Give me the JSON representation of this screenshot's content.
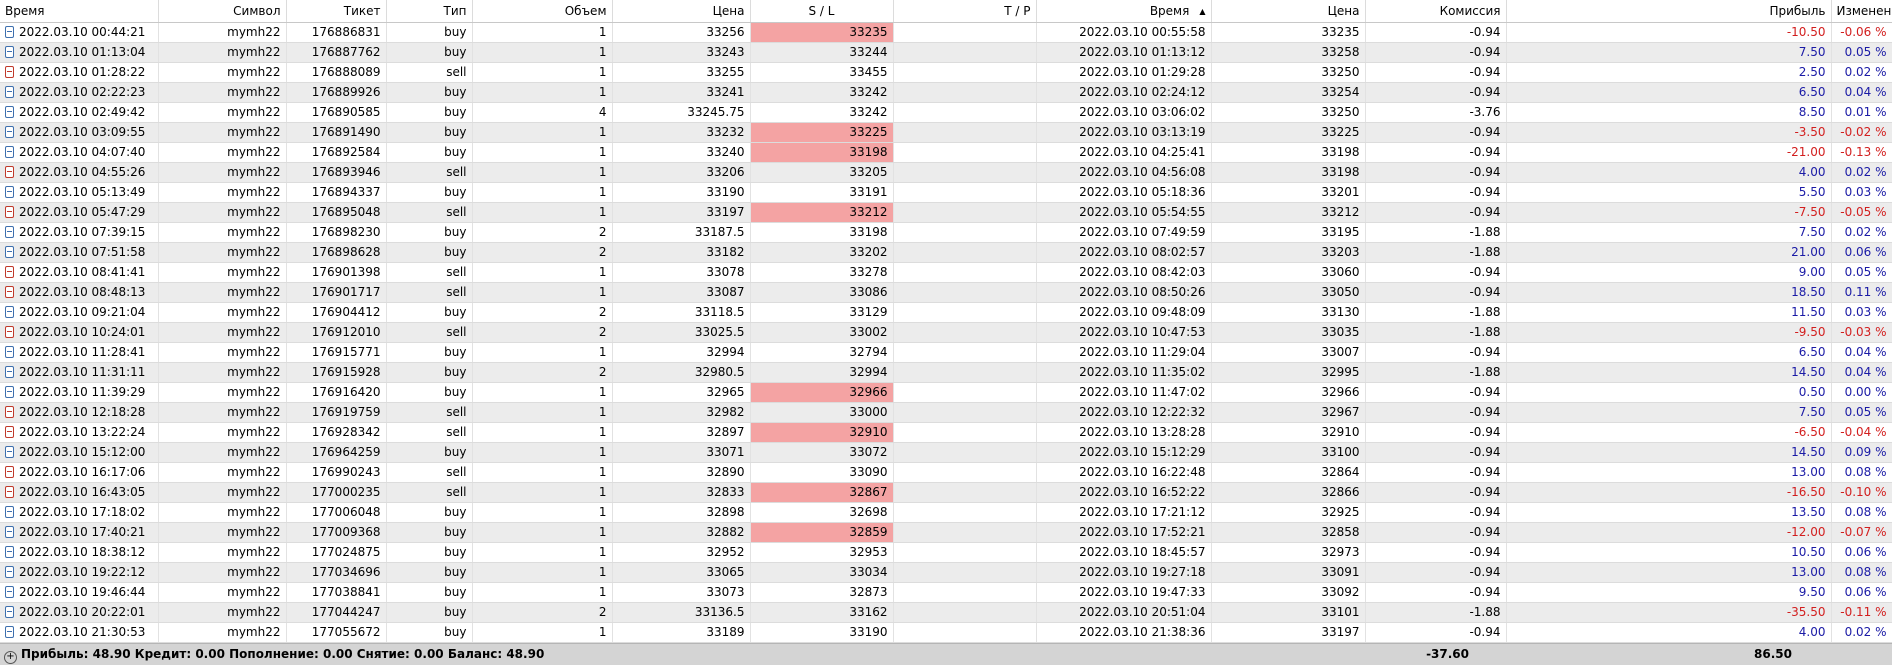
{
  "headers": {
    "time": "Время",
    "symbol": "Символ",
    "ticket": "Тикет",
    "type": "Тип",
    "volume": "Объем",
    "price": "Цена",
    "sl": "S / L",
    "tp": "T / P",
    "close_time": "Время",
    "close_price": "Цена",
    "commission": "Комиссия",
    "profit": "Прибыль",
    "change": "Изменение"
  },
  "sort_arrow": "▲",
  "rows": [
    {
      "time": "2022.03.10 00:44:21",
      "symbol": "mymh22",
      "ticket": "176886831",
      "type": "buy",
      "volume": "1",
      "price": "33256",
      "sl": "33235",
      "tp": "",
      "close_time": "2022.03.10 00:55:58",
      "close_price": "33235",
      "commission": "-0.94",
      "profit": "-10.50",
      "change": "-0.06 %",
      "sl_hit": true
    },
    {
      "time": "2022.03.10 01:13:04",
      "symbol": "mymh22",
      "ticket": "176887762",
      "type": "buy",
      "volume": "1",
      "price": "33243",
      "sl": "33244",
      "tp": "",
      "close_time": "2022.03.10 01:13:12",
      "close_price": "33258",
      "commission": "-0.94",
      "profit": "7.50",
      "change": "0.05 %",
      "sl_hit": false
    },
    {
      "time": "2022.03.10 01:28:22",
      "symbol": "mymh22",
      "ticket": "176888089",
      "type": "sell",
      "volume": "1",
      "price": "33255",
      "sl": "33455",
      "tp": "",
      "close_time": "2022.03.10 01:29:28",
      "close_price": "33250",
      "commission": "-0.94",
      "profit": "2.50",
      "change": "0.02 %",
      "sl_hit": false
    },
    {
      "time": "2022.03.10 02:22:23",
      "symbol": "mymh22",
      "ticket": "176889926",
      "type": "buy",
      "volume": "1",
      "price": "33241",
      "sl": "33242",
      "tp": "",
      "close_time": "2022.03.10 02:24:12",
      "close_price": "33254",
      "commission": "-0.94",
      "profit": "6.50",
      "change": "0.04 %",
      "sl_hit": false
    },
    {
      "time": "2022.03.10 02:49:42",
      "symbol": "mymh22",
      "ticket": "176890585",
      "type": "buy",
      "volume": "4",
      "price": "33245.75",
      "sl": "33242",
      "tp": "",
      "close_time": "2022.03.10 03:06:02",
      "close_price": "33250",
      "commission": "-3.76",
      "profit": "8.50",
      "change": "0.01 %",
      "sl_hit": false
    },
    {
      "time": "2022.03.10 03:09:55",
      "symbol": "mymh22",
      "ticket": "176891490",
      "type": "buy",
      "volume": "1",
      "price": "33232",
      "sl": "33225",
      "tp": "",
      "close_time": "2022.03.10 03:13:19",
      "close_price": "33225",
      "commission": "-0.94",
      "profit": "-3.50",
      "change": "-0.02 %",
      "sl_hit": true
    },
    {
      "time": "2022.03.10 04:07:40",
      "symbol": "mymh22",
      "ticket": "176892584",
      "type": "buy",
      "volume": "1",
      "price": "33240",
      "sl": "33198",
      "tp": "",
      "close_time": "2022.03.10 04:25:41",
      "close_price": "33198",
      "commission": "-0.94",
      "profit": "-21.00",
      "change": "-0.13 %",
      "sl_hit": true
    },
    {
      "time": "2022.03.10 04:55:26",
      "symbol": "mymh22",
      "ticket": "176893946",
      "type": "sell",
      "volume": "1",
      "price": "33206",
      "sl": "33205",
      "tp": "",
      "close_time": "2022.03.10 04:56:08",
      "close_price": "33198",
      "commission": "-0.94",
      "profit": "4.00",
      "change": "0.02 %",
      "sl_hit": false
    },
    {
      "time": "2022.03.10 05:13:49",
      "symbol": "mymh22",
      "ticket": "176894337",
      "type": "buy",
      "volume": "1",
      "price": "33190",
      "sl": "33191",
      "tp": "",
      "close_time": "2022.03.10 05:18:36",
      "close_price": "33201",
      "commission": "-0.94",
      "profit": "5.50",
      "change": "0.03 %",
      "sl_hit": false
    },
    {
      "time": "2022.03.10 05:47:29",
      "symbol": "mymh22",
      "ticket": "176895048",
      "type": "sell",
      "volume": "1",
      "price": "33197",
      "sl": "33212",
      "tp": "",
      "close_time": "2022.03.10 05:54:55",
      "close_price": "33212",
      "commission": "-0.94",
      "profit": "-7.50",
      "change": "-0.05 %",
      "sl_hit": true
    },
    {
      "time": "2022.03.10 07:39:15",
      "symbol": "mymh22",
      "ticket": "176898230",
      "type": "buy",
      "volume": "2",
      "price": "33187.5",
      "sl": "33198",
      "tp": "",
      "close_time": "2022.03.10 07:49:59",
      "close_price": "33195",
      "commission": "-1.88",
      "profit": "7.50",
      "change": "0.02 %",
      "sl_hit": false
    },
    {
      "time": "2022.03.10 07:51:58",
      "symbol": "mymh22",
      "ticket": "176898628",
      "type": "buy",
      "volume": "2",
      "price": "33182",
      "sl": "33202",
      "tp": "",
      "close_time": "2022.03.10 08:02:57",
      "close_price": "33203",
      "commission": "-1.88",
      "profit": "21.00",
      "change": "0.06 %",
      "sl_hit": false
    },
    {
      "time": "2022.03.10 08:41:41",
      "symbol": "mymh22",
      "ticket": "176901398",
      "type": "sell",
      "volume": "1",
      "price": "33078",
      "sl": "33278",
      "tp": "",
      "close_time": "2022.03.10 08:42:03",
      "close_price": "33060",
      "commission": "-0.94",
      "profit": "9.00",
      "change": "0.05 %",
      "sl_hit": false
    },
    {
      "time": "2022.03.10 08:48:13",
      "symbol": "mymh22",
      "ticket": "176901717",
      "type": "sell",
      "volume": "1",
      "price": "33087",
      "sl": "33086",
      "tp": "",
      "close_time": "2022.03.10 08:50:26",
      "close_price": "33050",
      "commission": "-0.94",
      "profit": "18.50",
      "change": "0.11 %",
      "sl_hit": false
    },
    {
      "time": "2022.03.10 09:21:04",
      "symbol": "mymh22",
      "ticket": "176904412",
      "type": "buy",
      "volume": "2",
      "price": "33118.5",
      "sl": "33129",
      "tp": "",
      "close_time": "2022.03.10 09:48:09",
      "close_price": "33130",
      "commission": "-1.88",
      "profit": "11.50",
      "change": "0.03 %",
      "sl_hit": false
    },
    {
      "time": "2022.03.10 10:24:01",
      "symbol": "mymh22",
      "ticket": "176912010",
      "type": "sell",
      "volume": "2",
      "price": "33025.5",
      "sl": "33002",
      "tp": "",
      "close_time": "2022.03.10 10:47:53",
      "close_price": "33035",
      "commission": "-1.88",
      "profit": "-9.50",
      "change": "-0.03 %",
      "sl_hit": false
    },
    {
      "time": "2022.03.10 11:28:41",
      "symbol": "mymh22",
      "ticket": "176915771",
      "type": "buy",
      "volume": "1",
      "price": "32994",
      "sl": "32794",
      "tp": "",
      "close_time": "2022.03.10 11:29:04",
      "close_price": "33007",
      "commission": "-0.94",
      "profit": "6.50",
      "change": "0.04 %",
      "sl_hit": false
    },
    {
      "time": "2022.03.10 11:31:11",
      "symbol": "mymh22",
      "ticket": "176915928",
      "type": "buy",
      "volume": "2",
      "price": "32980.5",
      "sl": "32994",
      "tp": "",
      "close_time": "2022.03.10 11:35:02",
      "close_price": "32995",
      "commission": "-1.88",
      "profit": "14.50",
      "change": "0.04 %",
      "sl_hit": false
    },
    {
      "time": "2022.03.10 11:39:29",
      "symbol": "mymh22",
      "ticket": "176916420",
      "type": "buy",
      "volume": "1",
      "price": "32965",
      "sl": "32966",
      "tp": "",
      "close_time": "2022.03.10 11:47:02",
      "close_price": "32966",
      "commission": "-0.94",
      "profit": "0.50",
      "change": "0.00 %",
      "sl_hit": true
    },
    {
      "time": "2022.03.10 12:18:28",
      "symbol": "mymh22",
      "ticket": "176919759",
      "type": "sell",
      "volume": "1",
      "price": "32982",
      "sl": "33000",
      "tp": "",
      "close_time": "2022.03.10 12:22:32",
      "close_price": "32967",
      "commission": "-0.94",
      "profit": "7.50",
      "change": "0.05 %",
      "sl_hit": false
    },
    {
      "time": "2022.03.10 13:22:24",
      "symbol": "mymh22",
      "ticket": "176928342",
      "type": "sell",
      "volume": "1",
      "price": "32897",
      "sl": "32910",
      "tp": "",
      "close_time": "2022.03.10 13:28:28",
      "close_price": "32910",
      "commission": "-0.94",
      "profit": "-6.50",
      "change": "-0.04 %",
      "sl_hit": true
    },
    {
      "time": "2022.03.10 15:12:00",
      "symbol": "mymh22",
      "ticket": "176964259",
      "type": "buy",
      "volume": "1",
      "price": "33071",
      "sl": "33072",
      "tp": "",
      "close_time": "2022.03.10 15:12:29",
      "close_price": "33100",
      "commission": "-0.94",
      "profit": "14.50",
      "change": "0.09 %",
      "sl_hit": false
    },
    {
      "time": "2022.03.10 16:17:06",
      "symbol": "mymh22",
      "ticket": "176990243",
      "type": "sell",
      "volume": "1",
      "price": "32890",
      "sl": "33090",
      "tp": "",
      "close_time": "2022.03.10 16:22:48",
      "close_price": "32864",
      "commission": "-0.94",
      "profit": "13.00",
      "change": "0.08 %",
      "sl_hit": false
    },
    {
      "time": "2022.03.10 16:43:05",
      "symbol": "mymh22",
      "ticket": "177000235",
      "type": "sell",
      "volume": "1",
      "price": "32833",
      "sl": "32867",
      "tp": "",
      "close_time": "2022.03.10 16:52:22",
      "close_price": "32866",
      "commission": "-0.94",
      "profit": "-16.50",
      "change": "-0.10 %",
      "sl_hit": true
    },
    {
      "time": "2022.03.10 17:18:02",
      "symbol": "mymh22",
      "ticket": "177006048",
      "type": "buy",
      "volume": "1",
      "price": "32898",
      "sl": "32698",
      "tp": "",
      "close_time": "2022.03.10 17:21:12",
      "close_price": "32925",
      "commission": "-0.94",
      "profit": "13.50",
      "change": "0.08 %",
      "sl_hit": false
    },
    {
      "time": "2022.03.10 17:40:21",
      "symbol": "mymh22",
      "ticket": "177009368",
      "type": "buy",
      "volume": "1",
      "price": "32882",
      "sl": "32859",
      "tp": "",
      "close_time": "2022.03.10 17:52:21",
      "close_price": "32858",
      "commission": "-0.94",
      "profit": "-12.00",
      "change": "-0.07 %",
      "sl_hit": true
    },
    {
      "time": "2022.03.10 18:38:12",
      "symbol": "mymh22",
      "ticket": "177024875",
      "type": "buy",
      "volume": "1",
      "price": "32952",
      "sl": "32953",
      "tp": "",
      "close_time": "2022.03.10 18:45:57",
      "close_price": "32973",
      "commission": "-0.94",
      "profit": "10.50",
      "change": "0.06 %",
      "sl_hit": false
    },
    {
      "time": "2022.03.10 19:22:12",
      "symbol": "mymh22",
      "ticket": "177034696",
      "type": "buy",
      "volume": "1",
      "price": "33065",
      "sl": "33034",
      "tp": "",
      "close_time": "2022.03.10 19:27:18",
      "close_price": "33091",
      "commission": "-0.94",
      "profit": "13.00",
      "change": "0.08 %",
      "sl_hit": false
    },
    {
      "time": "2022.03.10 19:46:44",
      "symbol": "mymh22",
      "ticket": "177038841",
      "type": "buy",
      "volume": "1",
      "price": "33073",
      "sl": "32873",
      "tp": "",
      "close_time": "2022.03.10 19:47:33",
      "close_price": "33092",
      "commission": "-0.94",
      "profit": "9.50",
      "change": "0.06 %",
      "sl_hit": false
    },
    {
      "time": "2022.03.10 20:22:01",
      "symbol": "mymh22",
      "ticket": "177044247",
      "type": "buy",
      "volume": "2",
      "price": "33136.5",
      "sl": "33162",
      "tp": "",
      "close_time": "2022.03.10 20:51:04",
      "close_price": "33101",
      "commission": "-1.88",
      "profit": "-35.50",
      "change": "-0.11 %",
      "sl_hit": false
    },
    {
      "time": "2022.03.10 21:30:53",
      "symbol": "mymh22",
      "ticket": "177055672",
      "type": "buy",
      "volume": "1",
      "price": "33189",
      "sl": "33190",
      "tp": "",
      "close_time": "2022.03.10 21:38:36",
      "close_price": "33197",
      "commission": "-0.94",
      "profit": "4.00",
      "change": "0.02 %",
      "sl_hit": false
    }
  ],
  "summary": {
    "plus_glyph": "+",
    "text": "Прибыль: 48.90  Кредит: 0.00  Пополнение: 0.00  Снятие: 0.00  Баланс: 48.90",
    "commission_total": "-37.60",
    "profit_total": "86.50"
  },
  "colors": {
    "sl_hit_bg": "#f4a3a3",
    "profit_positive": "#1a1aa6",
    "profit_negative": "#d21e1e",
    "row_alt_bg": "#ececec",
    "summary_bg": "#d4d4d4"
  },
  "icons": {
    "buy": "deal-buy-icon",
    "sell": "deal-sell-icon",
    "summary": "plus-circle-icon"
  }
}
